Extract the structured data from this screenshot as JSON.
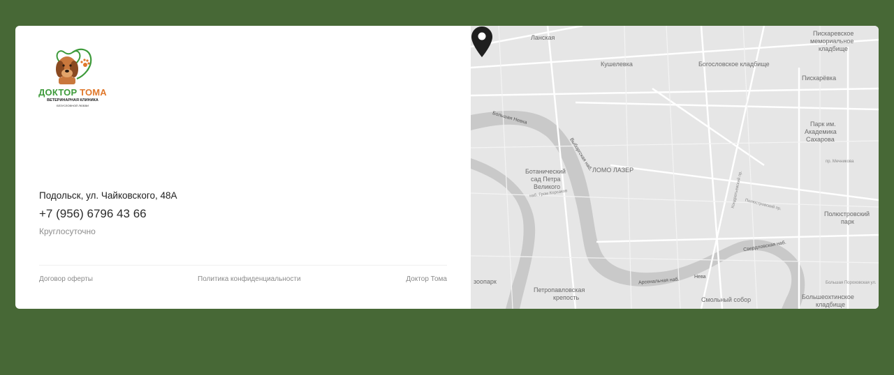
{
  "logo": {
    "title_part1": "ДОКТОР",
    "title_part2": "ТОМА",
    "subtitle": "ВЕТЕРИНАРНАЯ КЛИНИКА",
    "tagline": "БЕЗУСЛОВНОЙ ЛЮБВИ"
  },
  "contact": {
    "address": "Подольск, ул. Чайковского, 48А",
    "phone": "+7 (956) 6796 43 66",
    "hours": "Круглосуточно"
  },
  "footer": {
    "offer_link": "Договор оферты",
    "privacy_link": "Политика конфиденциальности",
    "brand": "Доктор Тома"
  },
  "map": {
    "labels": {
      "lanskaya": "Ланская",
      "piskarevskoe_cem_1": "Пискаревское",
      "piskarevskoe_cem_2": "мемориальное",
      "piskarevskoe_cem_3": "кладбище",
      "kushelevka": "Кушелевка",
      "bogoslovskoe": "Богословское кладбище",
      "piskarevka": "Пискарёвка",
      "park_sakharova_1": "Парк им.",
      "park_sakharova_2": "Академика",
      "park_sakharova_3": "Сахарова",
      "bolshaya_nevka": "Большая Невка",
      "vyborgskaya_nab": "Выборгская наб.",
      "botanical_1": "Ботанический",
      "botanical_2": "сад Петра",
      "botanical_3": "Великого",
      "lomo": "ЛОМО ЛАЗЕР",
      "polyustrovsky_1": "Полюстровский",
      "polyustrovsky_2": "парк",
      "sverdlovskaya": "Свердловская наб.",
      "zoopark": "зоопарк",
      "petropavlovsk_1": "Петропавловская",
      "petropavlovsk_2": "крепость",
      "arsenalnaya": "Арсенальная наб.",
      "neva": "Нева",
      "smolny": "Смольный собор",
      "bolsheokhtinskoe_1": "Большеохтинское",
      "bolsheokhtinskoe_2": "кладбище",
      "pirogovskaya": "наб. Гром Корсаков",
      "kondratievsky": "Кондратьевский пр.",
      "polyustrovsky_pr": "Полюстровский пр.",
      "mechnikova": "пр. Мечникова",
      "bolshaya_porokhovskaya": "Большая Пороховская ул."
    }
  }
}
